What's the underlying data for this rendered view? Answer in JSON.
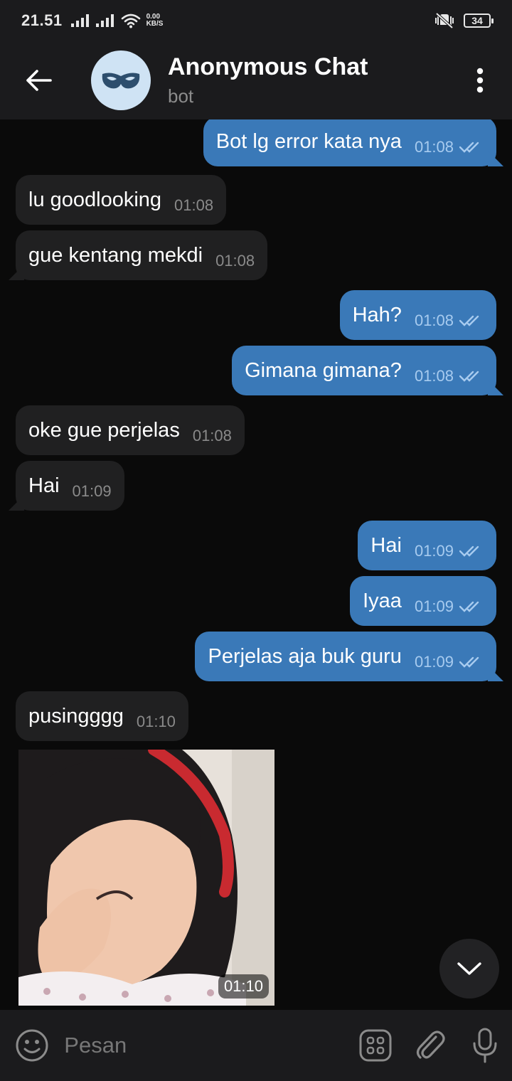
{
  "status_bar": {
    "time": "21.51",
    "net_speed_value": "0.00",
    "net_speed_unit": "KB/S",
    "battery": "34"
  },
  "header": {
    "title": "Anonymous Chat",
    "subtitle": "bot"
  },
  "messages": [
    {
      "dir": "out",
      "text": "Bot lg error kata nya",
      "time": "01:08"
    },
    {
      "dir": "in",
      "text": "lu goodlooking",
      "time": "01:08"
    },
    {
      "dir": "in",
      "text": "gue kentang mekdi",
      "time": "01:08"
    },
    {
      "dir": "out",
      "text": "Hah?",
      "time": "01:08"
    },
    {
      "dir": "out",
      "text": "Gimana gimana?",
      "time": "01:08"
    },
    {
      "dir": "in",
      "text": "oke gue perjelas",
      "time": "01:08"
    },
    {
      "dir": "in",
      "text": "Hai",
      "time": "01:09"
    },
    {
      "dir": "out",
      "text": "Hai",
      "time": "01:09"
    },
    {
      "dir": "out",
      "text": "Iyaa",
      "time": "01:09"
    },
    {
      "dir": "out",
      "text": "Perjelas aja buk guru",
      "time": "01:09"
    },
    {
      "dir": "in",
      "text": "pusingggg",
      "time": "01:10"
    }
  ],
  "photo_message": {
    "time": "01:10"
  },
  "input": {
    "placeholder": "Pesan"
  },
  "colors": {
    "outgoing_bubble": "#3a79b8",
    "incoming_bubble": "#202021",
    "header_bg": "#1b1b1d",
    "avatar_bg": "#cfe3f4",
    "avatar_mask": "#2d4e6d"
  },
  "icons": {
    "back": "arrow-left-icon",
    "menu": "more-vertical-icon",
    "avatar": "mask-icon",
    "emoji": "smiley-icon",
    "bot_commands": "bot-menu-icon",
    "attach": "paperclip-icon",
    "voice": "microphone-icon",
    "scroll": "chevron-down-icon"
  }
}
